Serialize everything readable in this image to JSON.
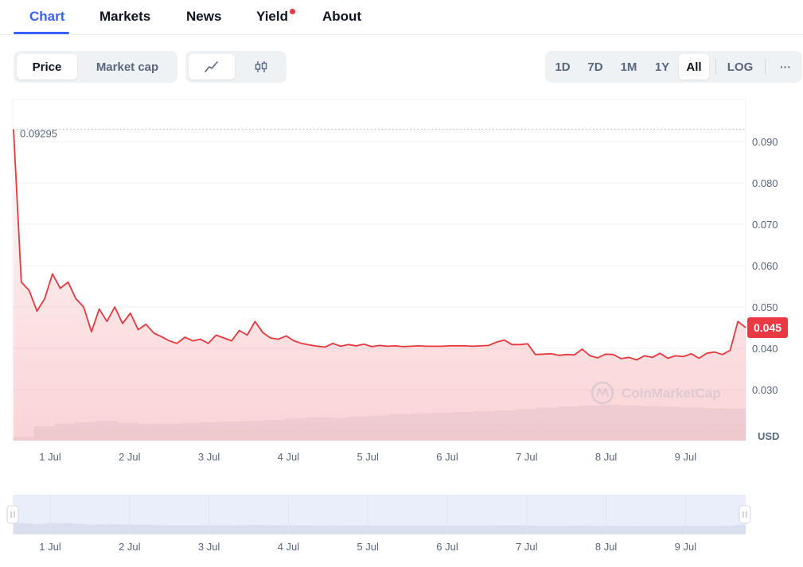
{
  "tabs": [
    {
      "label": "Chart",
      "active": true
    },
    {
      "label": "Markets",
      "active": false
    },
    {
      "label": "News",
      "active": false
    },
    {
      "label": "Yield",
      "active": false,
      "notification": true
    },
    {
      "label": "About",
      "active": false
    }
  ],
  "metric_toggle": {
    "options": [
      "Price",
      "Market cap"
    ],
    "selected": "Price"
  },
  "chart_type_toggle": {
    "options": [
      "line-chart-icon",
      "candlestick-icon"
    ],
    "selected": "line-chart-icon"
  },
  "range_toggle": {
    "options": [
      "1D",
      "7D",
      "1M",
      "1Y",
      "All"
    ],
    "selected": "All",
    "log_label": "LOG",
    "more_label": "···"
  },
  "colors": {
    "accent": "#3861fb",
    "price_line": "#e8383d",
    "badge": "#ea3943",
    "volume": "#eff2f5",
    "navigator": "#eaeefa"
  },
  "watermark": "CoinMarketCap",
  "chart_data": {
    "type": "line",
    "series": [
      {
        "values": [
          0.09295,
          0.056,
          0.054,
          0.049,
          0.052,
          0.058,
          0.0545,
          0.056,
          0.052,
          0.05,
          0.044,
          0.0495,
          0.0465,
          0.05,
          0.046,
          0.0485,
          0.0445,
          0.0458,
          0.0437,
          0.0428,
          0.0418,
          0.0412,
          0.0427,
          0.0418,
          0.0422,
          0.0412,
          0.0432,
          0.0425,
          0.0418,
          0.0443,
          0.0432,
          0.0465,
          0.0438,
          0.0425,
          0.0422,
          0.043,
          0.0418,
          0.0412,
          0.0408,
          0.0405,
          0.0403,
          0.0412,
          0.0405,
          0.0409,
          0.0406,
          0.041,
          0.0404,
          0.0407,
          0.0405,
          0.0406,
          0.0404,
          0.0405,
          0.0406,
          0.0405,
          0.0405,
          0.0405,
          0.0406,
          0.0406,
          0.0406,
          0.0405,
          0.0406,
          0.0407,
          0.0415,
          0.042,
          0.0409,
          0.0409,
          0.0411,
          0.0385,
          0.0386,
          0.0387,
          0.0383,
          0.0385,
          0.0384,
          0.0398,
          0.0382,
          0.0377,
          0.0386,
          0.0385,
          0.0375,
          0.0378,
          0.0372,
          0.0382,
          0.0378,
          0.0388,
          0.0376,
          0.0382,
          0.038,
          0.0387,
          0.0376,
          0.0388,
          0.0391,
          0.0385,
          0.0395,
          0.0465,
          0.045
        ]
      }
    ],
    "x_ticks": [
      "1 Jul",
      "2 Jul",
      "3 Jul",
      "4 Jul",
      "5 Jul",
      "6 Jul",
      "7 Jul",
      "8 Jul",
      "9 Jul"
    ],
    "y_ticks": [
      "0.090",
      "0.080",
      "0.070",
      "0.060",
      "0.050",
      "0.040",
      "0.030"
    ],
    "ylim": [
      0.0225,
      0.1025
    ],
    "max_label": "0.09295",
    "current_label": "0.045",
    "unit_label": "USD",
    "volume": [
      0.1,
      0.4,
      0.48,
      0.52,
      0.55,
      0.5,
      0.47,
      0.48,
      0.5,
      0.52,
      0.53,
      0.55,
      0.58,
      0.62,
      0.65,
      0.64,
      0.66,
      0.7,
      0.74,
      0.76,
      0.78,
      0.8,
      0.82,
      0.84,
      0.88,
      0.92,
      0.95,
      0.98,
      1.0,
      0.98,
      0.96,
      0.94,
      0.92,
      0.9,
      0.89
    ],
    "grid": true
  }
}
